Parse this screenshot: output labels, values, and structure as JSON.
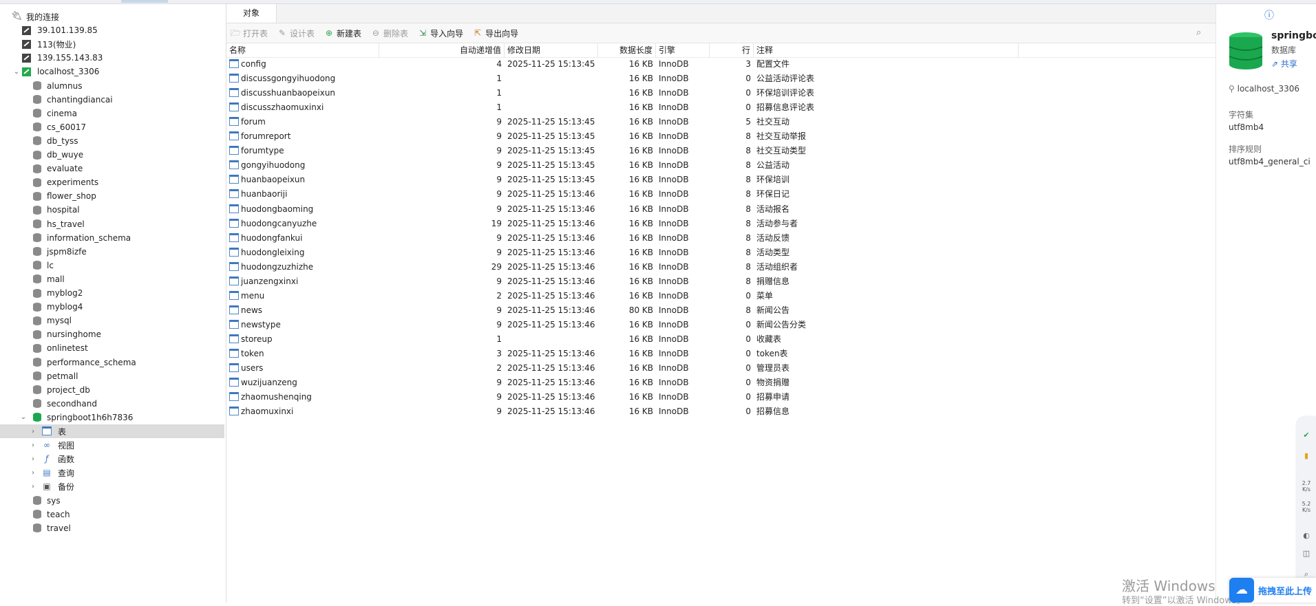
{
  "sidebar": {
    "root_label": "我的连接",
    "connections": [
      {
        "label": "39.101.139.85"
      },
      {
        "label": "113(物业)"
      },
      {
        "label": "139.155.143.83"
      },
      {
        "label": "localhost_3306"
      }
    ],
    "databases_before": [
      "alumnus",
      "chantingdiancai",
      "cinema",
      "cs_60017",
      "db_tyss",
      "db_wuye",
      "evaluate",
      "experiments",
      "flower_shop",
      "hospital",
      "hs_travel",
      "information_schema",
      "jspm8izfe",
      "lc",
      "mall",
      "myblog2",
      "myblog4",
      "mysql",
      "nursinghome",
      "onlinetest",
      "performance_schema",
      "petmall",
      "project_db",
      "secondhand"
    ],
    "open_db": "springboot1h6h7836",
    "open_db_children": [
      {
        "label": "表",
        "icon": "table-icon"
      },
      {
        "label": "视图",
        "icon": "view-icon"
      },
      {
        "label": "函数",
        "icon": "function-icon"
      },
      {
        "label": "查询",
        "icon": "query-icon"
      },
      {
        "label": "备份",
        "icon": "backup-icon"
      }
    ],
    "databases_after": [
      "sys",
      "teach",
      "travel"
    ]
  },
  "tabs": [
    {
      "label": "对象"
    }
  ],
  "toolbar": {
    "open_table": "打开表",
    "design_table": "设计表",
    "new_table": "新建表",
    "delete_table": "删除表",
    "import_wizard": "导入向导",
    "export_wizard": "导出向导"
  },
  "table": {
    "headers": {
      "name": "名称",
      "auto_inc": "自动递增值",
      "modified": "修改日期",
      "data_len": "数据长度",
      "engine": "引擎",
      "rows": "行",
      "comment": "注释"
    },
    "rows": [
      {
        "name": "config",
        "auto_inc": "4",
        "modified": "2025-11-25 15:13:45",
        "data_len": "16 KB",
        "engine": "InnoDB",
        "rows": "3",
        "comment": "配置文件"
      },
      {
        "name": "discussgongyihuodong",
        "auto_inc": "1",
        "modified": "",
        "data_len": "16 KB",
        "engine": "InnoDB",
        "rows": "0",
        "comment": "公益活动评论表"
      },
      {
        "name": "discusshuanbaopeixun",
        "auto_inc": "1",
        "modified": "",
        "data_len": "16 KB",
        "engine": "InnoDB",
        "rows": "0",
        "comment": "环保培训评论表"
      },
      {
        "name": "discusszhaomuxinxi",
        "auto_inc": "1",
        "modified": "",
        "data_len": "16 KB",
        "engine": "InnoDB",
        "rows": "0",
        "comment": "招募信息评论表"
      },
      {
        "name": "forum",
        "auto_inc": "9",
        "modified": "2025-11-25 15:13:45",
        "data_len": "16 KB",
        "engine": "InnoDB",
        "rows": "5",
        "comment": "社交互动"
      },
      {
        "name": "forumreport",
        "auto_inc": "9",
        "modified": "2025-11-25 15:13:45",
        "data_len": "16 KB",
        "engine": "InnoDB",
        "rows": "8",
        "comment": "社交互动举报"
      },
      {
        "name": "forumtype",
        "auto_inc": "9",
        "modified": "2025-11-25 15:13:45",
        "data_len": "16 KB",
        "engine": "InnoDB",
        "rows": "8",
        "comment": "社交互动类型"
      },
      {
        "name": "gongyihuodong",
        "auto_inc": "9",
        "modified": "2025-11-25 15:13:45",
        "data_len": "16 KB",
        "engine": "InnoDB",
        "rows": "8",
        "comment": "公益活动"
      },
      {
        "name": "huanbaopeixun",
        "auto_inc": "9",
        "modified": "2025-11-25 15:13:45",
        "data_len": "16 KB",
        "engine": "InnoDB",
        "rows": "8",
        "comment": "环保培训"
      },
      {
        "name": "huanbaoriji",
        "auto_inc": "9",
        "modified": "2025-11-25 15:13:46",
        "data_len": "16 KB",
        "engine": "InnoDB",
        "rows": "8",
        "comment": "环保日记"
      },
      {
        "name": "huodongbaoming",
        "auto_inc": "9",
        "modified": "2025-11-25 15:13:46",
        "data_len": "16 KB",
        "engine": "InnoDB",
        "rows": "8",
        "comment": "活动报名"
      },
      {
        "name": "huodongcanyuzhe",
        "auto_inc": "19",
        "modified": "2025-11-25 15:13:46",
        "data_len": "16 KB",
        "engine": "InnoDB",
        "rows": "8",
        "comment": "活动参与者"
      },
      {
        "name": "huodongfankui",
        "auto_inc": "9",
        "modified": "2025-11-25 15:13:46",
        "data_len": "16 KB",
        "engine": "InnoDB",
        "rows": "8",
        "comment": "活动反馈"
      },
      {
        "name": "huodongleixing",
        "auto_inc": "9",
        "modified": "2025-11-25 15:13:46",
        "data_len": "16 KB",
        "engine": "InnoDB",
        "rows": "8",
        "comment": "活动类型"
      },
      {
        "name": "huodongzuzhizhe",
        "auto_inc": "29",
        "modified": "2025-11-25 15:13:46",
        "data_len": "16 KB",
        "engine": "InnoDB",
        "rows": "8",
        "comment": "活动组织者"
      },
      {
        "name": "juanzengxinxi",
        "auto_inc": "9",
        "modified": "2025-11-25 15:13:46",
        "data_len": "16 KB",
        "engine": "InnoDB",
        "rows": "8",
        "comment": "捐赠信息"
      },
      {
        "name": "menu",
        "auto_inc": "2",
        "modified": "2025-11-25 15:13:46",
        "data_len": "16 KB",
        "engine": "InnoDB",
        "rows": "0",
        "comment": "菜单"
      },
      {
        "name": "news",
        "auto_inc": "9",
        "modified": "2025-11-25 15:13:46",
        "data_len": "80 KB",
        "engine": "InnoDB",
        "rows": "8",
        "comment": "新闻公告"
      },
      {
        "name": "newstype",
        "auto_inc": "9",
        "modified": "2025-11-25 15:13:46",
        "data_len": "16 KB",
        "engine": "InnoDB",
        "rows": "0",
        "comment": "新闻公告分类"
      },
      {
        "name": "storeup",
        "auto_inc": "1",
        "modified": "",
        "data_len": "16 KB",
        "engine": "InnoDB",
        "rows": "0",
        "comment": "收藏表"
      },
      {
        "name": "token",
        "auto_inc": "3",
        "modified": "2025-11-25 15:13:46",
        "data_len": "16 KB",
        "engine": "InnoDB",
        "rows": "0",
        "comment": "token表"
      },
      {
        "name": "users",
        "auto_inc": "2",
        "modified": "2025-11-25 15:13:46",
        "data_len": "16 KB",
        "engine": "InnoDB",
        "rows": "0",
        "comment": "管理员表"
      },
      {
        "name": "wuzijuanzeng",
        "auto_inc": "9",
        "modified": "2025-11-25 15:13:46",
        "data_len": "16 KB",
        "engine": "InnoDB",
        "rows": "0",
        "comment": "物资捐赠"
      },
      {
        "name": "zhaomushenqing",
        "auto_inc": "9",
        "modified": "2025-11-25 15:13:46",
        "data_len": "16 KB",
        "engine": "InnoDB",
        "rows": "0",
        "comment": "招募申请"
      },
      {
        "name": "zhaomuxinxi",
        "auto_inc": "9",
        "modified": "2025-11-25 15:13:46",
        "data_len": "16 KB",
        "engine": "InnoDB",
        "rows": "0",
        "comment": "招募信息"
      }
    ]
  },
  "info": {
    "db_name": "springbo",
    "db_type": "数据库",
    "share": "共享",
    "connection": "localhost_3306",
    "charset_label": "字符集",
    "charset": "utf8mb4",
    "collation_label": "排序规则",
    "collation": "utf8mb4_general_ci"
  },
  "overlay": {
    "watermark": "激活 Windows",
    "watermark_sub": "转到“设置”以激活 Windows。",
    "upload": "拖拽至此上传",
    "gadget_up": "2.7 K/s",
    "gadget_down": "5.2 K/s"
  },
  "colors": {
    "accent": "#1e7ff0",
    "db_green": "#1aa84e",
    "selection": "#dcdcdc"
  }
}
